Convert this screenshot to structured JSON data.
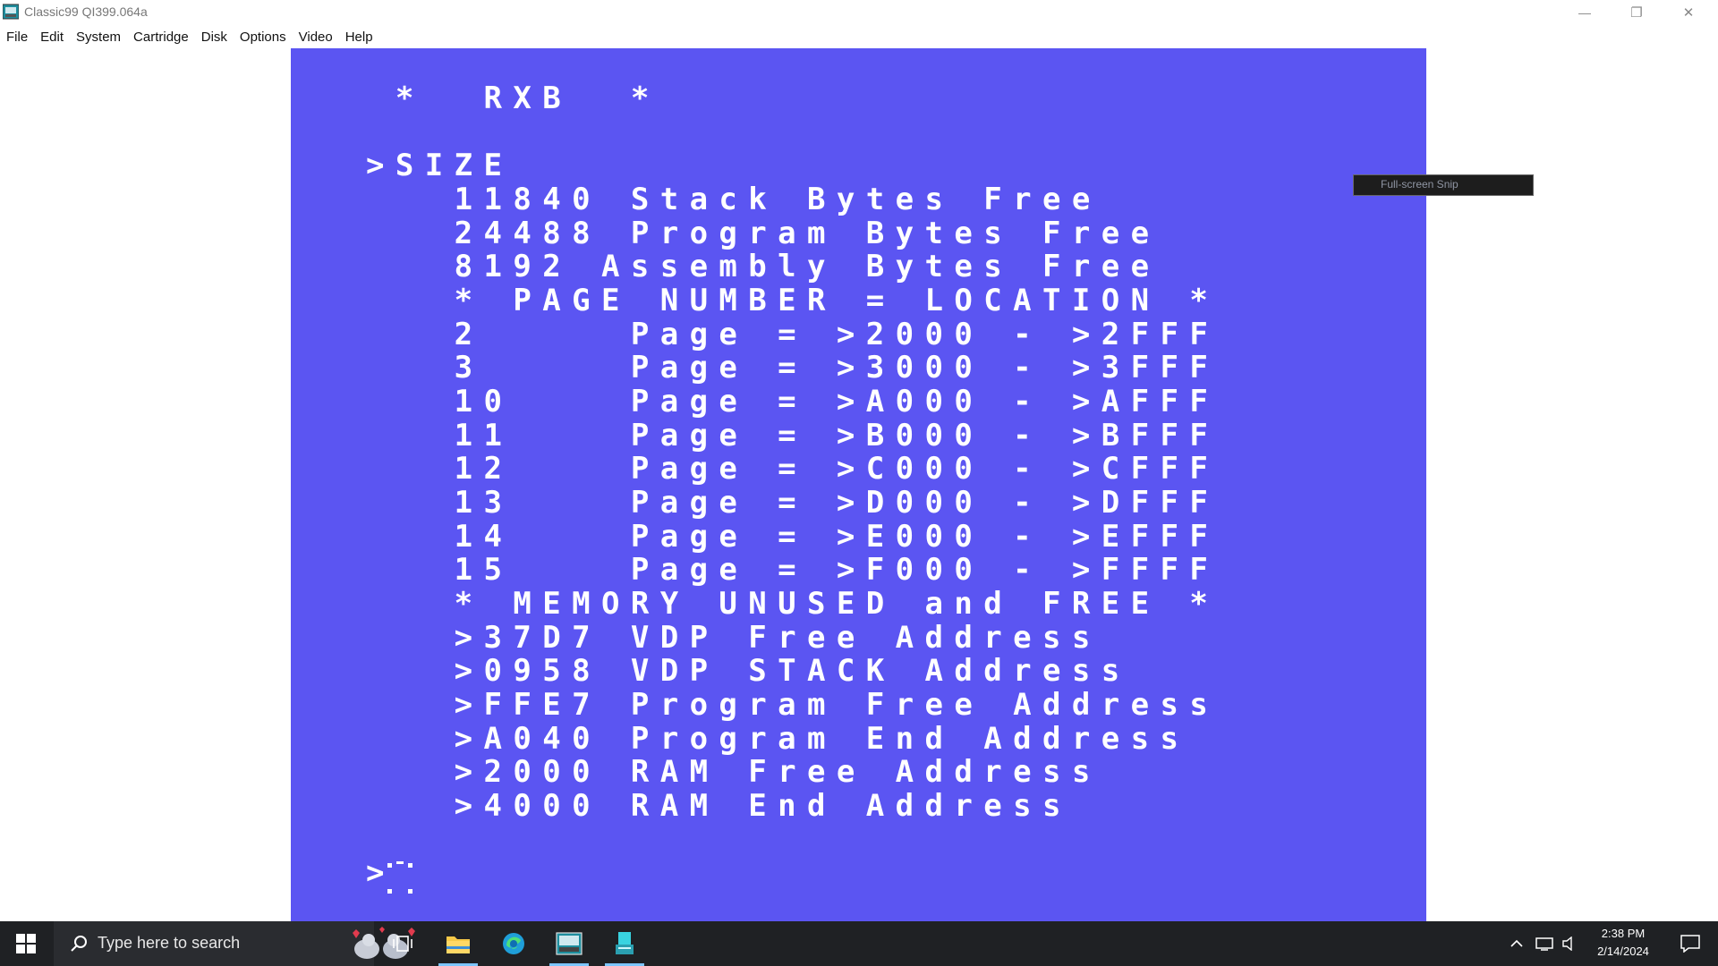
{
  "window": {
    "title": "Classic99 QI399.064a",
    "minimize_glyph": "—",
    "restore_glyph": "❐",
    "close_glyph": "✕"
  },
  "menu": [
    {
      "label": "File"
    },
    {
      "label": "Edit"
    },
    {
      "label": "System"
    },
    {
      "label": "Cartridge"
    },
    {
      "label": "Disk"
    },
    {
      "label": "Options"
    },
    {
      "label": "Video"
    },
    {
      "label": "Help"
    }
  ],
  "screen": {
    "background": "#5b55f2",
    "text_color": "#ffffff",
    "lines": [
      " *  RXB  *",
      "",
      ">SIZE",
      "   11840 Stack Bytes Free",
      "   24488 Program Bytes Free",
      "   8192 Assembly Bytes Free",
      "   * PAGE NUMBER = LOCATION *",
      "   2     Page = >2000 - >2FFF",
      "   3     Page = >3000 - >3FFF",
      "   10    Page = >A000 - >AFFF",
      "   11    Page = >B000 - >BFFF",
      "   12    Page = >C000 - >CFFF",
      "   13    Page = >D000 - >DFFF",
      "   14    Page = >E000 - >EFFF",
      "   15    Page = >F000 - >FFFF",
      "   * MEMORY UNUSED and FREE *",
      "   >37D7 VDP Free Address",
      "   >0958 VDP STACK Address",
      "   >FFE7 Program Free Address",
      "   >A040 Program End Address",
      "   >2000 RAM Free Address",
      "   >4000 RAM End Address"
    ],
    "prompt": ">"
  },
  "snip_overlay": {
    "label": "Full-screen Snip"
  },
  "taskbar": {
    "search_placeholder": "Type here to search",
    "icons": [
      "windows-icon",
      "task-view-icon",
      "file-explorer-icon",
      "edge-icon",
      "classic99-icon",
      "app-icon"
    ],
    "clock_time": "2:38 PM",
    "clock_date": "2/14/2024"
  }
}
